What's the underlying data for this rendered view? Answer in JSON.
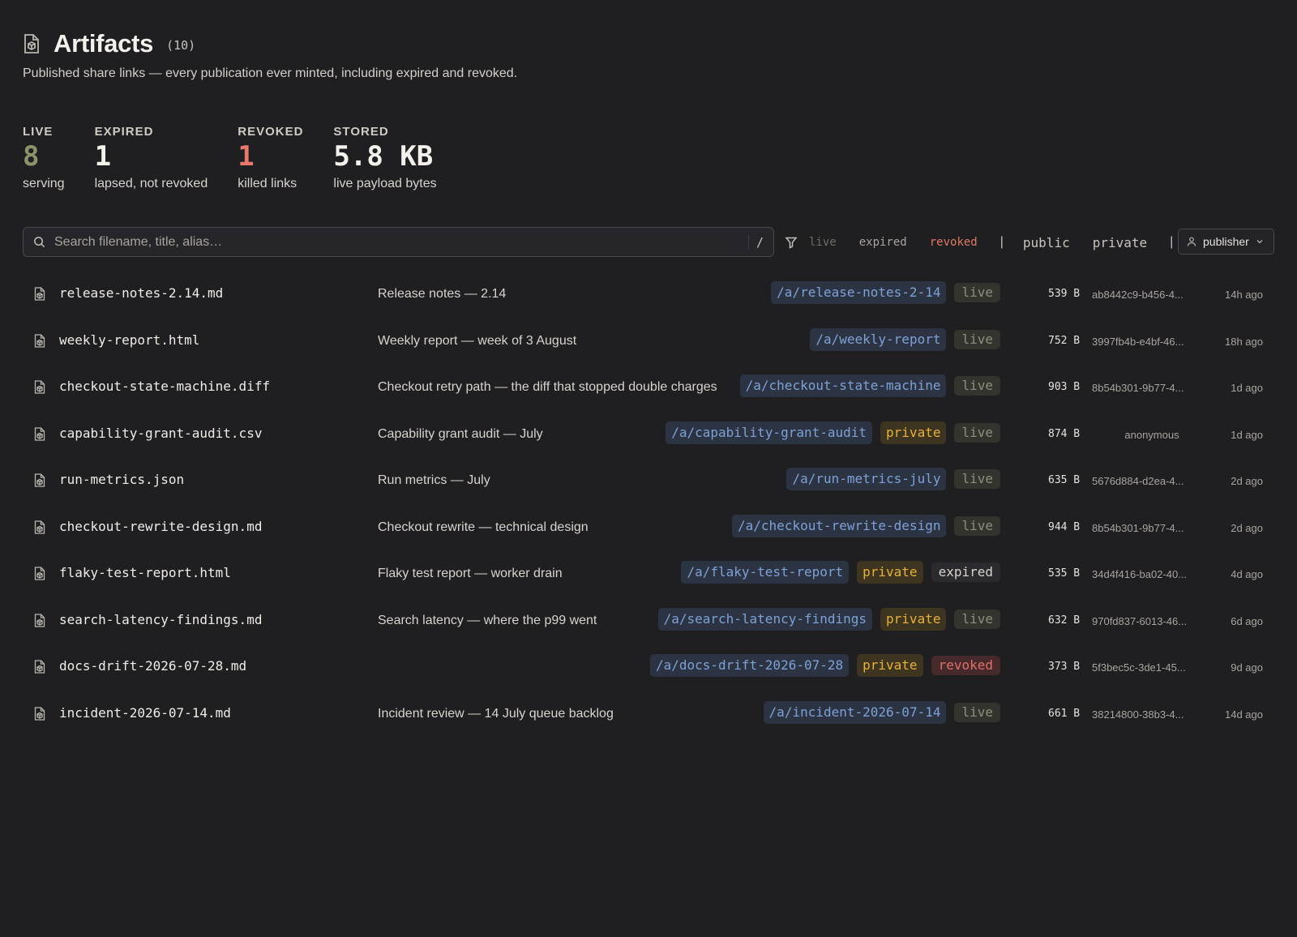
{
  "header": {
    "title": "Artifacts",
    "count": "(10)",
    "subtitle": "Published share links — every publication ever minted, including expired and revoked."
  },
  "stats": [
    {
      "label": "LIVE",
      "value": "8",
      "desc": "serving",
      "color": "#8a9468"
    },
    {
      "label": "EXPIRED",
      "value": "1",
      "desc": "lapsed, not revoked",
      "color": "#f4f1ec"
    },
    {
      "label": "REVOKED",
      "value": "1",
      "desc": "killed links",
      "color": "#e8786a"
    },
    {
      "label": "STORED",
      "value": "5.8 KB",
      "desc": "live payload bytes",
      "color": "#f4f1ec"
    }
  ],
  "search": {
    "placeholder": "Search filename, title, alias…",
    "shortcut": "/"
  },
  "filters": {
    "status": [
      "live",
      "expired",
      "revoked"
    ],
    "visibility": [
      "public",
      "private"
    ],
    "separator": "|",
    "publisher_label": "publisher"
  },
  "rows": [
    {
      "filename": "release-notes-2.14.md",
      "title": "Release notes — 2.14",
      "alias": "/a/release-notes-2-14",
      "private": "",
      "status": "live",
      "size": "539 B",
      "publisher": "ab8442c9-b456-4...",
      "age": "14h ago"
    },
    {
      "filename": "weekly-report.html",
      "title": "Weekly report — week of 3 August",
      "alias": "/a/weekly-report",
      "private": "",
      "status": "live",
      "size": "752 B",
      "publisher": "3997fb4b-e4bf-46...",
      "age": "18h ago"
    },
    {
      "filename": "checkout-state-machine.diff",
      "title": "Checkout retry path — the diff that stopped double charges",
      "alias": "/a/checkout-state-machine",
      "private": "",
      "status": "live",
      "size": "903 B",
      "publisher": "8b54b301-9b77-4...",
      "age": "1d ago"
    },
    {
      "filename": "capability-grant-audit.csv",
      "title": "Capability grant audit — July",
      "alias": "/a/capability-grant-audit",
      "private": "private",
      "status": "live",
      "size": "874 B",
      "publisher": "anonymous",
      "age": "1d ago"
    },
    {
      "filename": "run-metrics.json",
      "title": "Run metrics — July",
      "alias": "/a/run-metrics-july",
      "private": "",
      "status": "live",
      "size": "635 B",
      "publisher": "5676d884-d2ea-4...",
      "age": "2d ago"
    },
    {
      "filename": "checkout-rewrite-design.md",
      "title": "Checkout rewrite — technical design",
      "alias": "/a/checkout-rewrite-design",
      "private": "",
      "status": "live",
      "size": "944 B",
      "publisher": "8b54b301-9b77-4...",
      "age": "2d ago"
    },
    {
      "filename": "flaky-test-report.html",
      "title": "Flaky test report — worker drain",
      "alias": "/a/flaky-test-report",
      "private": "private",
      "status": "expired",
      "size": "535 B",
      "publisher": "34d4f416-ba02-40...",
      "age": "4d ago"
    },
    {
      "filename": "search-latency-findings.md",
      "title": "Search latency — where the p99 went",
      "alias": "/a/search-latency-findings",
      "private": "private",
      "status": "live",
      "size": "632 B",
      "publisher": "970fd837-6013-46...",
      "age": "6d ago"
    },
    {
      "filename": "docs-drift-2026-07-28.md",
      "title": "",
      "alias": "/a/docs-drift-2026-07-28",
      "private": "private",
      "status": "revoked",
      "size": "373 B",
      "publisher": "5f3bec5c-3de1-45...",
      "age": "9d ago"
    },
    {
      "filename": "incident-2026-07-14.md",
      "title": "Incident review — 14 July queue backlog",
      "alias": "/a/incident-2026-07-14",
      "private": "",
      "status": "live",
      "size": "661 B",
      "publisher": "38214800-38b3-4...",
      "age": "14d ago"
    }
  ]
}
